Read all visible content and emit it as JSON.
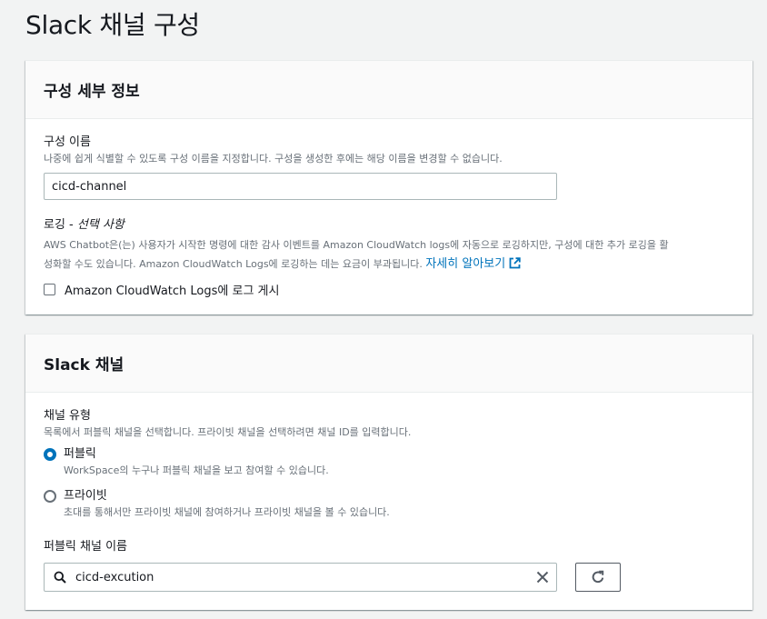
{
  "page": {
    "title": "Slack 채널 구성"
  },
  "config_details": {
    "title": "구성 세부 정보",
    "name_label": "구성 이름",
    "name_desc": "나중에 쉽게 식별할 수 있도록 구성 이름을 지정합니다. 구성을 생성한 후에는 해당 이름을 변경할 수 없습니다.",
    "name_value": "cicd-channel",
    "logging_label": "로깅 - ",
    "logging_optional": "선택 사항",
    "logging_desc_line1": "AWS Chatbot은(는) 사용자가 시작한 명령에 대한 감사 이벤트를 Amazon CloudWatch logs에 자동으로 로깅하지만, 구성에 대한 추가 로깅을 활",
    "logging_desc_line2": "성화할 수도 있습니다. Amazon CloudWatch Logs에 로깅하는 데는 요금이 부과됩니다.",
    "learn_more": "자세히 알아보기",
    "checkbox_label": "Amazon CloudWatch Logs에 로그 게시"
  },
  "slack_channel": {
    "title": "Slack 채널",
    "type_label": "채널 유형",
    "type_desc": "목록에서 퍼블릭 채널을 선택합니다. 프라이빗 채널을 선택하려면 채널 ID를 입력합니다.",
    "options": [
      {
        "title": "퍼블릭",
        "desc": "WorkSpace의 누구나 퍼블릭 채널을 보고 참여할 수 있습니다.",
        "selected": true
      },
      {
        "title": "프라이빗",
        "desc": "초대를 통해서만 프라이빗 채널에 참여하거나 프라이빗 채널을 볼 수 있습니다.",
        "selected": false
      }
    ],
    "public_name_label": "퍼블릭 채널 이름",
    "public_name_value": "cicd-excution"
  },
  "colors": {
    "accent": "#0073bb",
    "background": "#f2f3f3",
    "text": "#16191f",
    "muted": "#687078"
  }
}
